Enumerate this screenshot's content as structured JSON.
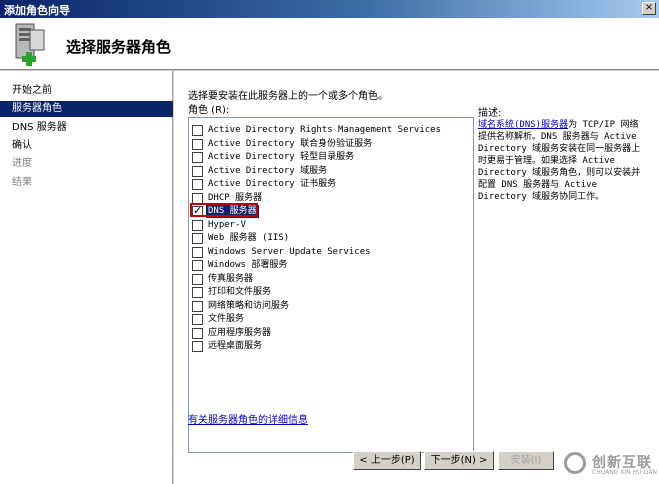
{
  "window": {
    "title": "添加角色向导",
    "close": "×"
  },
  "header": {
    "title": "选择服务器角色",
    "icon": "server-add-icon"
  },
  "sidebar": {
    "items": [
      {
        "label": "开始之前",
        "state": "normal"
      },
      {
        "label": "服务器角色",
        "state": "active"
      },
      {
        "label": "DNS 服务器",
        "state": "normal"
      },
      {
        "label": "确认",
        "state": "normal"
      },
      {
        "label": "进度",
        "state": "dim"
      },
      {
        "label": "结果",
        "state": "dim"
      }
    ]
  },
  "main": {
    "instruction": "选择要安装在此服务器上的一个或多个角色。",
    "roles_label": "角色 (R):",
    "roles": [
      {
        "label": "Active Directory Rights Management Services",
        "checked": false
      },
      {
        "label": "Active Directory 联合身份验证服务",
        "checked": false
      },
      {
        "label": "Active Directory 轻型目录服务",
        "checked": false
      },
      {
        "label": "Active Directory 域服务",
        "checked": false
      },
      {
        "label": "Active Directory 证书服务",
        "checked": false
      },
      {
        "label": "DHCP 服务器",
        "checked": false
      },
      {
        "label": "DNS 服务器",
        "checked": true,
        "selected": true
      },
      {
        "label": "Hyper-V",
        "checked": false
      },
      {
        "label": "Web 服务器 (IIS)",
        "checked": false
      },
      {
        "label": "Windows Server Update Services",
        "checked": false
      },
      {
        "label": "Windows 部署服务",
        "checked": false
      },
      {
        "label": "传真服务器",
        "checked": false
      },
      {
        "label": "打印和文件服务",
        "checked": false
      },
      {
        "label": "网络策略和访问服务",
        "checked": false
      },
      {
        "label": "文件服务",
        "checked": false
      },
      {
        "label": "应用程序服务器",
        "checked": false
      },
      {
        "label": "远程桌面服务",
        "checked": false
      }
    ],
    "description_title": "描述:",
    "description_link": "域名系统(DNS)服务器",
    "description_text": "为 TCP/IP 网络提供名称解析。DNS 服务器与 Active Directory 域服务安装在同一服务器上时更易于管理。如果选择 Active Directory 域服务角色，则可以安装并配置 DNS 服务器与 Active Directory 域服务协同工作。",
    "more_info_link": "有关服务器角色的详细信息"
  },
  "buttons": {
    "back": "< 上一步(P)",
    "next": "下一步(N) >",
    "install": "安装(I)"
  },
  "watermark": {
    "brand": "创新互联",
    "sub": "CHUANG XIN HU LIAN"
  },
  "colors": {
    "selection": "#0a246a",
    "link": "#0000cc",
    "highlight_box": "#c00000"
  }
}
